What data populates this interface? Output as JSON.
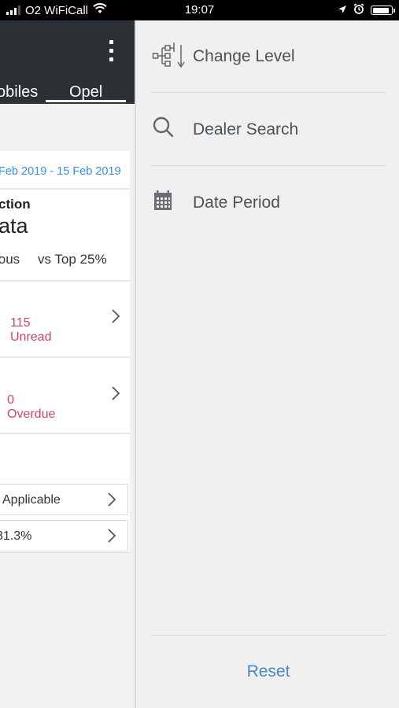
{
  "status_bar": {
    "carrier": "O2 WiFiCall",
    "time": "19:07",
    "icons": [
      "signal-icon",
      "wifi-icon",
      "location-icon",
      "alarm-icon",
      "battery-icon"
    ]
  },
  "app": {
    "tabs": [
      {
        "label": "obiles"
      },
      {
        "label": "Opel"
      }
    ],
    "date_range": "Feb 2019 - 15 Feb 2019",
    "section_label": "ction",
    "section_title": "ata",
    "compare": {
      "previous": "ious",
      "top": "vs Top 25%"
    },
    "metrics": [
      {
        "value": "115",
        "label": "Unread"
      },
      {
        "value": "0",
        "label": "Overdue"
      }
    ],
    "rows": [
      {
        "text": "Applicable"
      },
      {
        "text": "81.3%"
      }
    ],
    "accent_color": "#d0416c",
    "header_color": "#2c3135"
  },
  "drawer": {
    "items": [
      {
        "label": "Change Level",
        "icon": "hierarchy-icon"
      },
      {
        "label": "Dealer Search",
        "icon": "search-icon"
      },
      {
        "label": "Date Period",
        "icon": "calendar-icon"
      }
    ],
    "reset_label": "Reset",
    "link_color": "#4a86c5"
  }
}
